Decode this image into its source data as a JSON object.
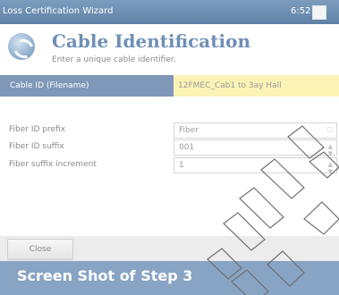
{
  "window": {
    "title": "Loss Certification Wizard",
    "clock": "6:52"
  },
  "header": {
    "title": "Cable Identification",
    "subtitle": "Enter a unique cable identifier.",
    "icon": "wizard-swirl-icon"
  },
  "cable_id": {
    "label": "Cable ID (Filename)",
    "value": "12FMEC_Cab1 to 3ay Hall"
  },
  "fields": [
    {
      "label": "Fiber ID prefix",
      "value": "Fiber"
    },
    {
      "label": "Fiber ID suffix",
      "value": "001"
    },
    {
      "label": "Fiber suffix increment",
      "value": "1"
    }
  ],
  "bottom": {
    "close_label": "Close"
  },
  "caption": {
    "text": "Screen Shot of Step 3"
  },
  "colors": {
    "titlebar": "#5e82a6",
    "accent_header": "#6f8fb4",
    "id_label_bg": "#7f98b9",
    "id_value_bg": "#fbf3b6",
    "caption_bg": "#88a4c5"
  }
}
